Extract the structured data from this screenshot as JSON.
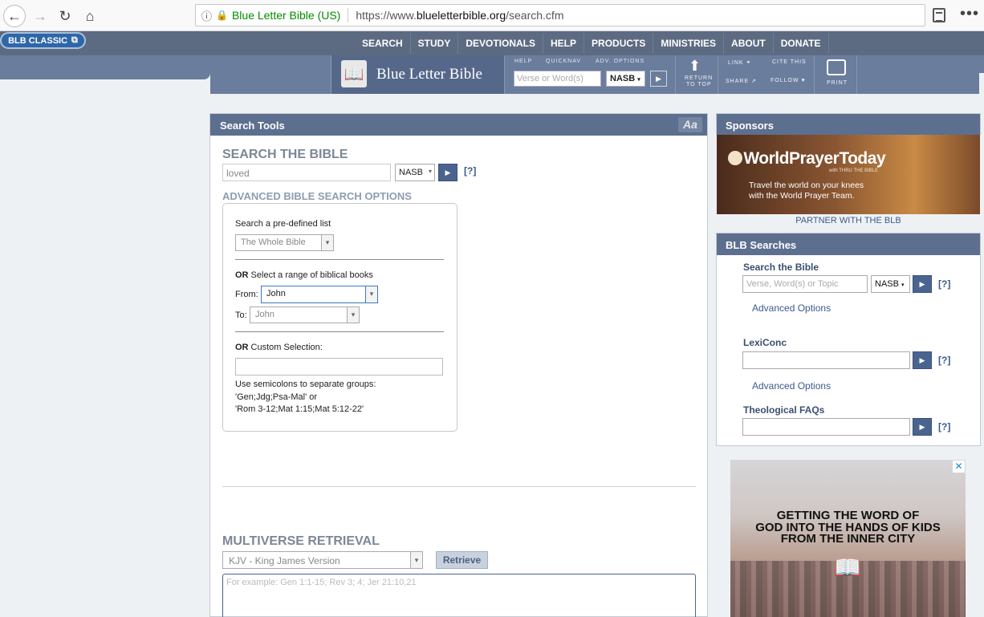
{
  "browser": {
    "site_identity": "Blue Letter Bible (US)",
    "url_prefix": "https://www.",
    "url_domain": "blueletterbible.org",
    "url_path": "/search.cfm"
  },
  "header": {
    "classic_label": "BLB CLASSIC",
    "nav": [
      "SEARCH",
      "STUDY",
      "DEVOTIONALS",
      "HELP",
      "PRODUCTS",
      "MINISTRIES",
      "ABOUT",
      "DONATE"
    ],
    "logo_text": "Blue Letter Bible",
    "qs_labels": [
      "HELP",
      "QUICKNAV",
      "ADV. OPTIONS"
    ],
    "qs_placeholder": "Verse or Word(s)",
    "qs_version": "NASB",
    "return_top": [
      "RETURN",
      "TO TOP"
    ],
    "link_label": "LINK",
    "cite_label": "CITE THIS",
    "share_label": "SHARE",
    "follow_label": "FOLLOW",
    "print_label": "PRINT"
  },
  "search_tools": {
    "title": "Search Tools",
    "font_toggle": "Aa",
    "search_heading": "SEARCH THE BIBLE",
    "search_value": "loved",
    "version": "NASB",
    "help": "[?]",
    "adv_heading": "ADVANCED BIBLE SEARCH OPTIONS",
    "predefined_label": "Search a pre-defined list",
    "predefined_value": "The Whole Bible",
    "or": "OR",
    "range_label": " Select a range of biblical books",
    "from_label": "From:",
    "from_value": "John",
    "to_label": "To:",
    "to_value": "John",
    "custom_label": " Custom Selection:",
    "custom_help_1": "Use semicolons to separate groups:",
    "custom_help_2": "'Gen;Jdg;Psa-Mal' or",
    "custom_help_3": "'Rom 3-12;Mat 1:15;Mat 5:12-22'",
    "multi_heading": "MULTIVERSE RETRIEVAL",
    "multi_version": "KJV - King James Version",
    "retrieve": "Retrieve",
    "multi_placeholder": "For example: Gen 1:1-15; Rev 3; 4; Jer 21:10,21"
  },
  "sponsors": {
    "title": "Sponsors",
    "ad_title": "WorldPrayerToday",
    "ad_small": "with THRU THE BIBLE",
    "ad_line1": "Travel the world on your knees",
    "ad_line2": "with the World Prayer Team.",
    "partner": "PARTNER WITH THE BLB"
  },
  "blb_searches": {
    "title": "BLB Searches",
    "search_label": "Search the Bible",
    "search_placeholder": "Verse, Word(s) or Topic",
    "version": "NASB",
    "help": "[?]",
    "advanced": "Advanced Options",
    "lexiconc_label": "LexiConc",
    "faq_label": "Theological FAQs"
  },
  "kids_ad": {
    "line1": "GETTING THE WORD OF",
    "line2": "GOD INTO THE HANDS OF KIDS",
    "line3": "FROM THE INNER CITY"
  }
}
